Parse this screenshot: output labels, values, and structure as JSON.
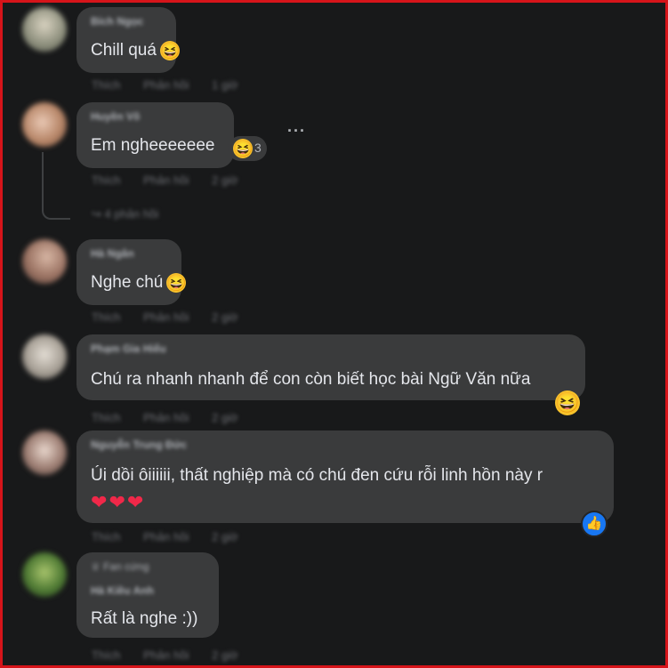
{
  "colors": {
    "background": "#18191a",
    "bubble": "#3a3b3c",
    "text": "#e4e6eb",
    "muted": "#b0b3b8",
    "frame": "#d6141a",
    "like": "#1877f2",
    "heart": "#f02849"
  },
  "comments": [
    {
      "author": "Bích Ngọc",
      "text": "Chill quá",
      "emoji": "😆",
      "actions": [
        "Thích",
        "Phản hồi",
        "1 giờ"
      ]
    },
    {
      "author": "Huyền Võ",
      "text": "Em ngheeeeeee",
      "emoji": "😆",
      "reaction_count": "3",
      "actions": [
        "Thích",
        "Phản hồi",
        "2 giờ"
      ],
      "replies_label": "4 phản hồi",
      "more_icon": "more-dots-icon"
    },
    {
      "author": "Hà Ngân",
      "text": "Nghe chú",
      "emoji": "😆",
      "actions": [
        "Thích",
        "Phản hồi",
        "2 giờ"
      ]
    },
    {
      "author": "Phạm Gia Hiếu",
      "text": "Chú ra nhanh nhanh để con còn biết học bài Ngữ Văn nữa",
      "emoji": "😆",
      "actions": [
        "Thích",
        "Phản hồi",
        "2 giờ"
      ]
    },
    {
      "author": "Nguyễn Trung Đức",
      "text": "Úi dồi ôiiiiii, thất nghiệp mà có chú đen cứu rỗi linh hồn này r",
      "hearts": [
        "❤",
        "❤",
        "❤"
      ],
      "reaction_icon": "like-icon",
      "actions": [
        "Thích",
        "Phản hồi",
        "2 giờ"
      ]
    },
    {
      "badge": "Fan cứng",
      "author": "Hà Kiều Anh",
      "text": "Rất là nghe :))",
      "actions": [
        "Thích",
        "Phản hồi",
        "2 giờ"
      ]
    }
  ]
}
